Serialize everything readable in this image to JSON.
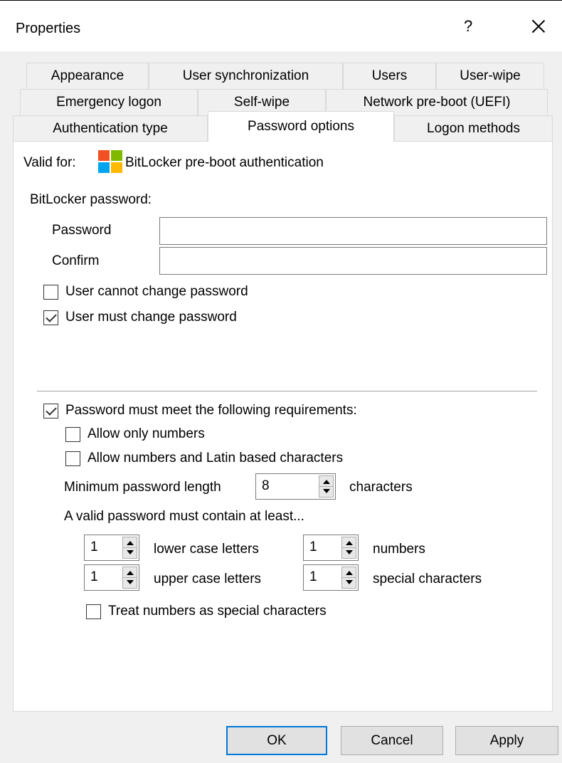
{
  "window": {
    "title": "Properties",
    "help_label": "?"
  },
  "tabs": {
    "row1": [
      "Appearance",
      "User synchronization",
      "Users",
      "User-wipe"
    ],
    "row2": [
      "Emergency logon",
      "Self-wipe",
      "Network pre-boot (UEFI)"
    ],
    "row3": [
      "Authentication type",
      "Password options",
      "Logon methods"
    ],
    "active": "Password options"
  },
  "valid_for": {
    "label": "Valid for:",
    "icon": "windows-logo-icon",
    "value": "BitLocker pre-boot authentication",
    "logo_colors": [
      "#f25022",
      "#7fba00",
      "#00a4ef",
      "#ffb900"
    ]
  },
  "bitlocker": {
    "group_label": "BitLocker password:",
    "password_label": "Password",
    "password_value": "",
    "confirm_label": "Confirm",
    "confirm_value": "",
    "cannot_change": {
      "label": "User cannot change password",
      "checked": false
    },
    "must_change": {
      "label": "User must change password",
      "checked": true
    }
  },
  "requirements": {
    "enabled": {
      "label": "Password must meet the following requirements:",
      "checked": true
    },
    "only_numbers": {
      "label": "Allow only numbers",
      "checked": false
    },
    "numbers_latin": {
      "label": "Allow numbers and Latin based characters",
      "checked": false
    },
    "min_length_label": "Minimum password length",
    "min_length_value": "8",
    "min_length_unit": "characters",
    "contain_label": "A valid password must contain at least...",
    "lower": {
      "value": "1",
      "label": "lower case letters"
    },
    "numbers": {
      "value": "1",
      "label": "numbers"
    },
    "upper": {
      "value": "1",
      "label": "upper case letters"
    },
    "special": {
      "value": "1",
      "label": "special characters"
    },
    "treat_numbers": {
      "label": "Treat numbers as special characters",
      "checked": false
    }
  },
  "buttons": {
    "ok": "OK",
    "cancel": "Cancel",
    "apply": "Apply"
  },
  "colors": {
    "default_button_border": "#0078d7",
    "dialog_bg": "#f0f0f0"
  }
}
